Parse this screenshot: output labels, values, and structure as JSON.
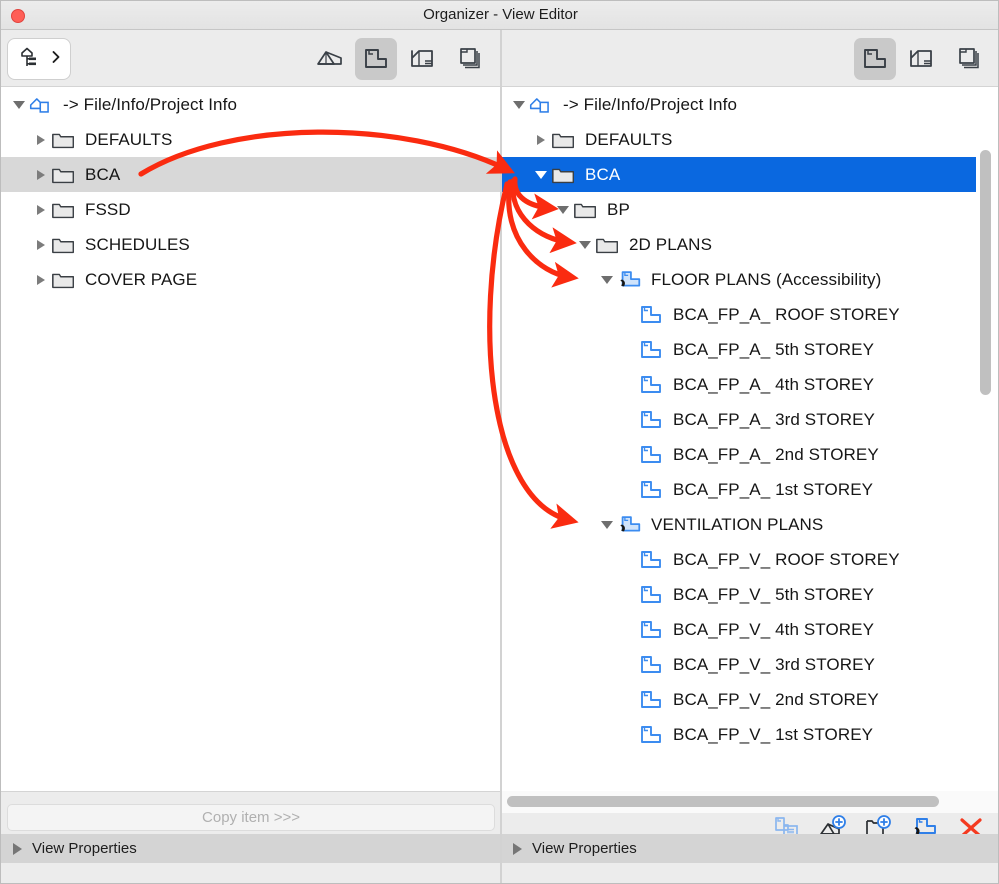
{
  "window": {
    "title": "Organizer - View Editor",
    "close_button": "close-window"
  },
  "left_panel": {
    "toolbar": {
      "combo_label": "view-map-selector",
      "icons": [
        {
          "name": "3d-view-icon",
          "active": false
        },
        {
          "name": "floor-plan-icon",
          "active": true
        },
        {
          "name": "section-icon",
          "active": false
        },
        {
          "name": "layout-sheets-icon",
          "active": false
        }
      ]
    },
    "tree": [
      {
        "label": "-> File/Info/Project Info",
        "icon": "project-info-icon",
        "depth": 0,
        "state": "expanded",
        "selected": false
      },
      {
        "label": "DEFAULTS",
        "icon": "folder-icon",
        "depth": 1,
        "state": "collapsed",
        "selected": false
      },
      {
        "label": "BCA",
        "icon": "folder-icon",
        "depth": 1,
        "state": "collapsed",
        "selected": "grey"
      },
      {
        "label": "FSSD",
        "icon": "folder-icon",
        "depth": 1,
        "state": "collapsed",
        "selected": false
      },
      {
        "label": "SCHEDULES",
        "icon": "folder-icon",
        "depth": 1,
        "state": "collapsed",
        "selected": false
      },
      {
        "label": "COVER PAGE",
        "icon": "folder-icon",
        "depth": 1,
        "state": "collapsed",
        "selected": false
      }
    ],
    "copy_button": "Copy item >>>",
    "view_properties": "View Properties"
  },
  "right_panel": {
    "toolbar": {
      "icons": [
        {
          "name": "floor-plan-icon",
          "active": true
        },
        {
          "name": "section-icon",
          "active": false
        },
        {
          "name": "layout-sheets-icon",
          "active": false
        }
      ]
    },
    "tree": [
      {
        "label": "-> File/Info/Project Info",
        "icon": "project-info-icon",
        "depth": 0,
        "state": "expanded",
        "selected": false
      },
      {
        "label": "DEFAULTS",
        "icon": "folder-icon",
        "depth": 1,
        "state": "collapsed",
        "selected": false
      },
      {
        "label": "BCA",
        "icon": "folder-icon",
        "depth": 1,
        "state": "expanded",
        "selected": "blue"
      },
      {
        "label": "BP",
        "icon": "folder-icon",
        "depth": 2,
        "state": "expanded",
        "selected": false
      },
      {
        "label": "2D PLANS",
        "icon": "folder-icon",
        "depth": 3,
        "state": "expanded",
        "selected": false
      },
      {
        "label": "FLOOR PLANS (Accessibility)",
        "icon": "view-clone-icon",
        "depth": 4,
        "state": "expanded",
        "selected": false
      },
      {
        "label": "BCA_FP_A_ ROOF STOREY",
        "icon": "view-icon",
        "depth": 5,
        "state": "leaf",
        "selected": false
      },
      {
        "label": "BCA_FP_A_ 5th STOREY",
        "icon": "view-icon",
        "depth": 5,
        "state": "leaf",
        "selected": false
      },
      {
        "label": "BCA_FP_A_ 4th STOREY",
        "icon": "view-icon",
        "depth": 5,
        "state": "leaf",
        "selected": false
      },
      {
        "label": "BCA_FP_A_ 3rd STOREY",
        "icon": "view-icon",
        "depth": 5,
        "state": "leaf",
        "selected": false
      },
      {
        "label": "BCA_FP_A_ 2nd STOREY",
        "icon": "view-icon",
        "depth": 5,
        "state": "leaf",
        "selected": false
      },
      {
        "label": "BCA_FP_A_ 1st STOREY",
        "icon": "view-icon",
        "depth": 5,
        "state": "leaf",
        "selected": false
      },
      {
        "label": "VENTILATION PLANS",
        "icon": "view-clone-icon",
        "depth": 4,
        "state": "expanded",
        "selected": false
      },
      {
        "label": "BCA_FP_V_ ROOF STOREY",
        "icon": "view-icon",
        "depth": 5,
        "state": "leaf",
        "selected": false
      },
      {
        "label": "BCA_FP_V_ 5th STOREY",
        "icon": "view-icon",
        "depth": 5,
        "state": "leaf",
        "selected": false
      },
      {
        "label": "BCA_FP_V_ 4th STOREY",
        "icon": "view-icon",
        "depth": 5,
        "state": "leaf",
        "selected": false
      },
      {
        "label": "BCA_FP_V_ 3rd STOREY",
        "icon": "view-icon",
        "depth": 5,
        "state": "leaf",
        "selected": false
      },
      {
        "label": "BCA_FP_V_ 2nd STOREY",
        "icon": "view-icon",
        "depth": 5,
        "state": "leaf",
        "selected": false
      },
      {
        "label": "BCA_FP_V_ 1st STOREY",
        "icon": "view-icon",
        "depth": 5,
        "state": "leaf",
        "selected": false
      }
    ],
    "action_icons": [
      {
        "name": "clone-view-settings-icon"
      },
      {
        "name": "new-3d-view-icon"
      },
      {
        "name": "new-folder-icon"
      },
      {
        "name": "new-clone-folder-icon"
      },
      {
        "name": "delete-icon"
      }
    ],
    "view_properties": "View Properties"
  },
  "annotations": {
    "arrow_color": "#FA2B10",
    "count": 5,
    "description": "Red annotation arrows from left BCA folder to right panel BCA, BP, 2D PLANS, FLOOR PLANS (Accessibility) and VENTILATION PLANS"
  },
  "colors": {
    "selection_blue": "#0A68E0",
    "selection_grey": "#D8D8D8",
    "toolbar_grey": "#ECECEC",
    "accent_blue": "#3C8CF0",
    "arrow_red": "#FA2B10",
    "close_red": "#FF5F57"
  }
}
